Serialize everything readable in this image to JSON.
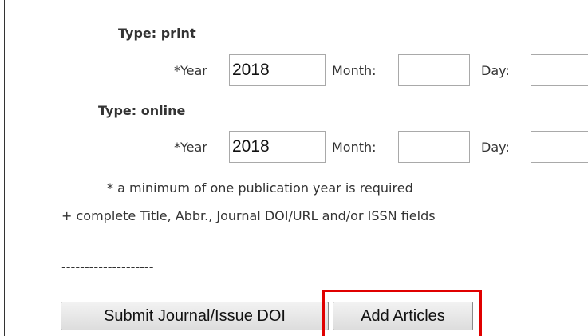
{
  "print": {
    "type_label": "Type: print",
    "year_label": "*Year",
    "year_value": "2018",
    "month_label": "Month:",
    "month_value": "",
    "day_label": "Day:",
    "day_value": ""
  },
  "online": {
    "type_label": "Type: online",
    "year_label": "*Year",
    "year_value": "2018",
    "month_label": "Month:",
    "month_value": "",
    "day_label": "Day:",
    "day_value": ""
  },
  "notes": {
    "required_note": "* a minimum of one publication year is required",
    "complete_note": "+ complete Title, Abbr., Journal DOI/URL and/or ISSN fields"
  },
  "separator": "--------------------",
  "buttons": {
    "submit_label": "Submit Journal/Issue DOI",
    "add_articles_label": "Add Articles"
  },
  "colors": {
    "highlight": "#e00000"
  }
}
